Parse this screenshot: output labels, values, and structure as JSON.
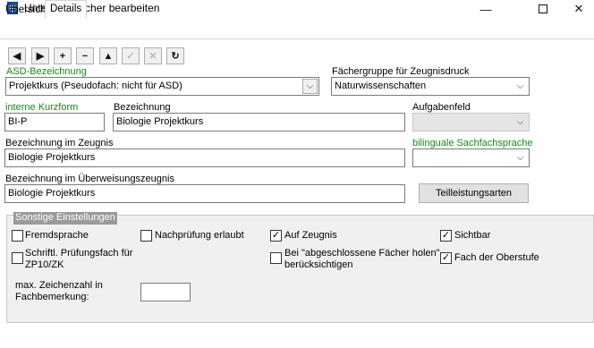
{
  "window": {
    "title": "Unterrichtsfächer bearbeiten",
    "minimize": "—",
    "maximize": "",
    "close": "✕"
  },
  "tabs": [
    {
      "label": "Übersicht",
      "active": false
    },
    {
      "label": "Details",
      "active": true
    }
  ],
  "toolbar": {
    "prev": "◀",
    "next": "▶",
    "add": "+",
    "remove": "−",
    "up": "▲",
    "confirm": "✓",
    "discard": "✕",
    "refresh": "↻"
  },
  "form": {
    "asd_label": "ASD-Bezeichnung",
    "asd_value": "Projektkurs (Pseudofach: nicht für ASD)",
    "faechergruppe_label": "Fächergruppe für Zeugnisdruck",
    "faechergruppe_value": "Naturwissenschaften",
    "kurzform_label": "interne Kurzform",
    "kurzform_value": "BI-P",
    "bezeichnung_label": "Bezeichnung",
    "bezeichnung_value": "Biologie Projektkurs",
    "aufgabenfeld_label": "Aufgabenfeld",
    "aufgabenfeld_value": "",
    "zeugnis_label": "Bezeichnung im Zeugnis",
    "zeugnis_value": "Biologie Projektkurs",
    "bilingual_label": "bilinguale Sachfachsprache",
    "bilingual_value": "",
    "ueberweisung_label": "Bezeichnung im Überweisungszeugnis",
    "ueberweisung_value": "Biologie Projektkurs",
    "teilleistung_button": "Teilleistungsarten"
  },
  "settings": {
    "title": "Sonstige Einstellungen",
    "fremdsprache": {
      "label": "Fremdsprache",
      "checked": false
    },
    "nachpruefung": {
      "label": "Nachprüfung erlaubt",
      "checked": false
    },
    "auf_zeugnis": {
      "label": "Auf Zeugnis",
      "checked": true
    },
    "sichtbar": {
      "label": "Sichtbar",
      "checked": true
    },
    "schriftl_line1": "Schriftl. Prüfungsfach für",
    "schriftl_line2": "ZP10/ZK",
    "schriftl_checked": false,
    "abgeschlossen_line1": "Bei \"abgeschlossene Fächer holen\"",
    "abgeschlossen_line2": "berücksichtigen",
    "abgeschlossen_checked": false,
    "oberstufe": {
      "label": "Fach der Oberstufe",
      "checked": true
    },
    "max_zeichen_line1": "max. Zeichenzahl in",
    "max_zeichen_line2": "Fachbemerkung:",
    "max_zeichen_value": ""
  },
  "icons": {
    "check": "✓",
    "dropdown": "⌵"
  },
  "colors": {
    "required_label": "#138a13",
    "group_title_bg": "#9a9a9a"
  }
}
